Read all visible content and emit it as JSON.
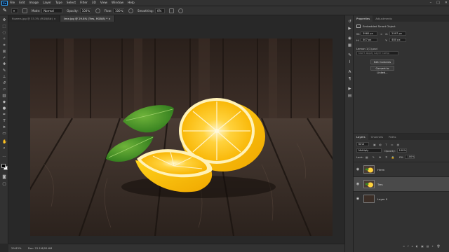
{
  "menu": {
    "logo": "Ps",
    "items": [
      "File",
      "Edit",
      "Image",
      "Layer",
      "Type",
      "Select",
      "Filter",
      "3D",
      "View",
      "Window",
      "Help"
    ],
    "window_controls": [
      "–",
      "□",
      "✕"
    ]
  },
  "options": {
    "mode_label": "Mode:",
    "mode_value": "Normal",
    "opacity_label": "Opacity:",
    "opacity_value": "100%",
    "flow_label": "Flow:",
    "flow_value": "100%",
    "smoothing_label": "Smoothing:",
    "smoothing_value": "0%"
  },
  "tabs": [
    {
      "label": "flowers.jpg @ 33.3% (RGB/8#) ×",
      "active": false
    },
    {
      "label": "lime.jpg @ 29.8% (Tres, RGB/8) * ×",
      "active": true
    }
  ],
  "status": {
    "zoom": "29.83%",
    "doc": "Doc: 22.1M/92.6M"
  },
  "properties": {
    "tabs": [
      "Properties",
      "Adjustments"
    ],
    "object_type": "Embedded Smart Object",
    "w_label": "W:",
    "w_value": "3960 px",
    "x_label": "X:",
    "x_value": "2097 px",
    "h_label": "H:",
    "h_value": "407 px",
    "y_label": "Y:",
    "y_value": "480 px",
    "source_label": "Lemon 1(1).psd",
    "no_comps": "Don't Apply Layer Comp",
    "edit_contents": "Edit Contents",
    "convert_linked": "Convert to Linked..."
  },
  "layers_panel": {
    "tabs": [
      "Layers",
      "Channels",
      "Paths"
    ],
    "filter_value": "Kind",
    "blend_mode": "Multiply",
    "opacity_label": "Opacity:",
    "opacity_value": "100%",
    "lock_label": "Lock:",
    "fill_label": "Fill:",
    "fill_value": "100%",
    "layers": [
      {
        "name": "Hmm",
        "selected": false
      },
      {
        "name": "Tres",
        "selected": true
      },
      {
        "name": "Layer 0",
        "selected": false
      }
    ],
    "footer_icons": [
      "∞",
      "fx",
      "◐",
      "▣",
      "▤",
      "+",
      "🗑"
    ]
  },
  "colors": {
    "accent": "#31a8ff",
    "panel": "#323232",
    "workspace": "#282828"
  }
}
